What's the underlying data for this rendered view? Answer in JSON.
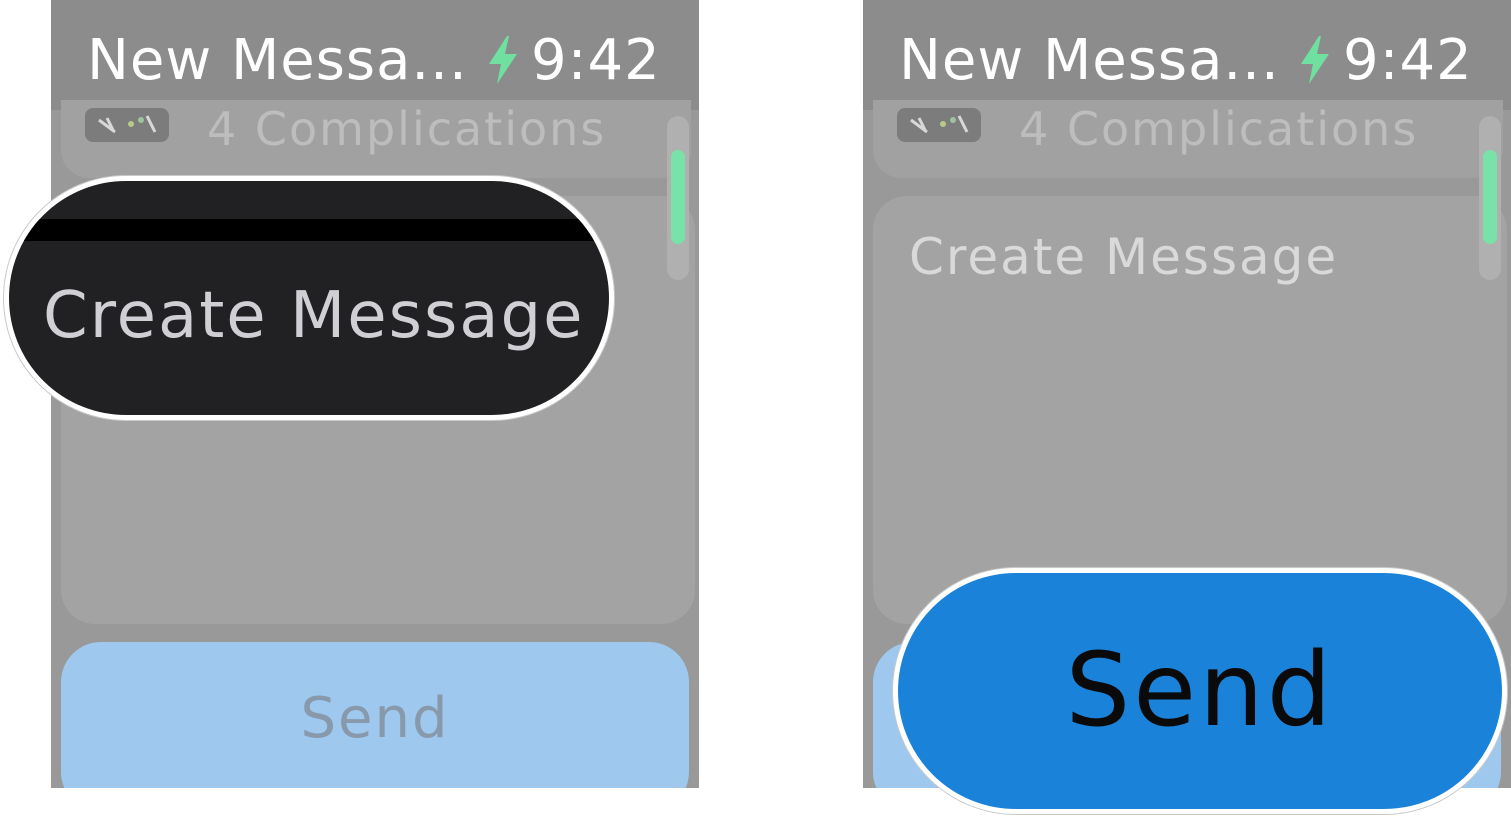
{
  "status_bar": {
    "title": "New Messa...",
    "time": "9:42",
    "icon": "charging-bolt-icon",
    "bolt_color": "#6fe0a0"
  },
  "complications_row": {
    "label": "4 Complications",
    "icon": "watch-face-thumbnail-icon"
  },
  "message_card": {
    "label": "Create Message"
  },
  "send_button": {
    "label": "Send",
    "color": "#1a82d9"
  },
  "callouts": {
    "create_message": "Create Message",
    "send": "Send"
  },
  "scroll_indicator": {
    "color": "#79e2a8"
  }
}
